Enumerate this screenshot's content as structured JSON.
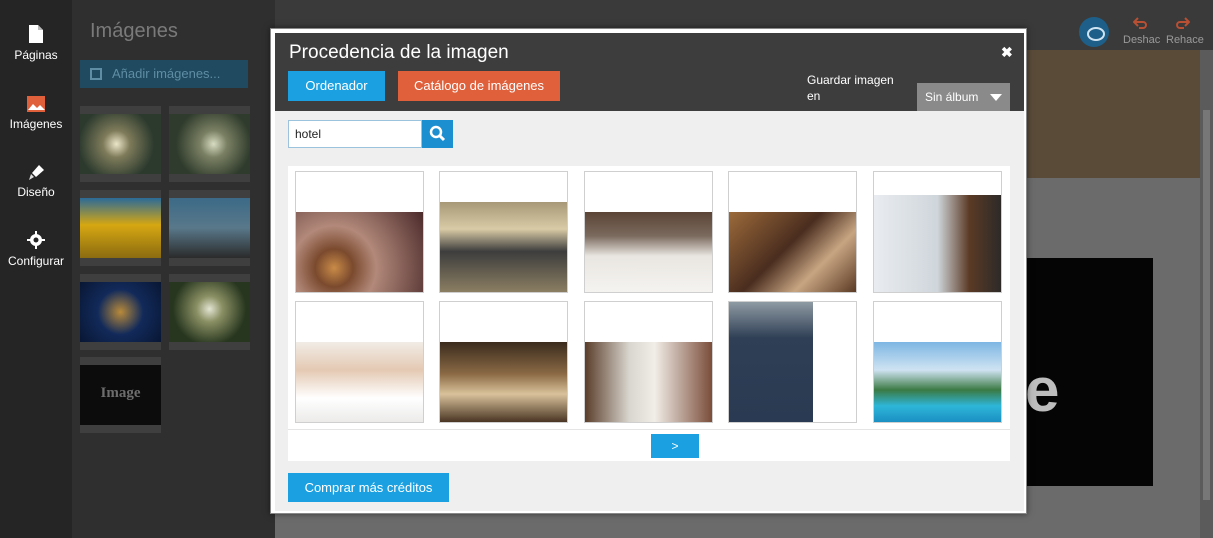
{
  "sidebar": {
    "items": [
      {
        "label": "Páginas",
        "icon": "page-icon"
      },
      {
        "label": "Imágenes",
        "icon": "image-icon",
        "active": true
      },
      {
        "label": "Diseño",
        "icon": "brush-icon"
      },
      {
        "label": "Configurar",
        "icon": "gear-icon"
      }
    ]
  },
  "panel": {
    "title": "Imágenes",
    "add_label": "Añadir imágenes...",
    "placeholder_label": "Image"
  },
  "toolbar": {
    "undo_label": "Deshac",
    "redo_label": "Rehace"
  },
  "modal": {
    "title": "Procedencia de la imagen",
    "close_label": "✖",
    "tabs": [
      {
        "label": "Ordenador",
        "color": "#1ba1e2"
      },
      {
        "label": "Catálogo de imágenes",
        "color": "#e0603b"
      }
    ],
    "save_label": "Guardar imagen en",
    "album": {
      "selected": "Sin álbum"
    },
    "search": {
      "value": "hotel"
    },
    "results": [
      {
        "subject": "hotel bell"
      },
      {
        "subject": "hotel staff"
      },
      {
        "subject": "white bed"
      },
      {
        "subject": "hotel room"
      },
      {
        "subject": "woman at window"
      },
      {
        "subject": "towels with flower"
      },
      {
        "subject": "hotel lounge"
      },
      {
        "subject": "bedroom"
      },
      {
        "subject": "bellboy"
      },
      {
        "subject": "hotel pool"
      }
    ],
    "next_label": ">",
    "buy_label": "Comprar más créditos"
  },
  "colors": {
    "accent": "#1ba1e2",
    "catalog": "#e0603b"
  }
}
